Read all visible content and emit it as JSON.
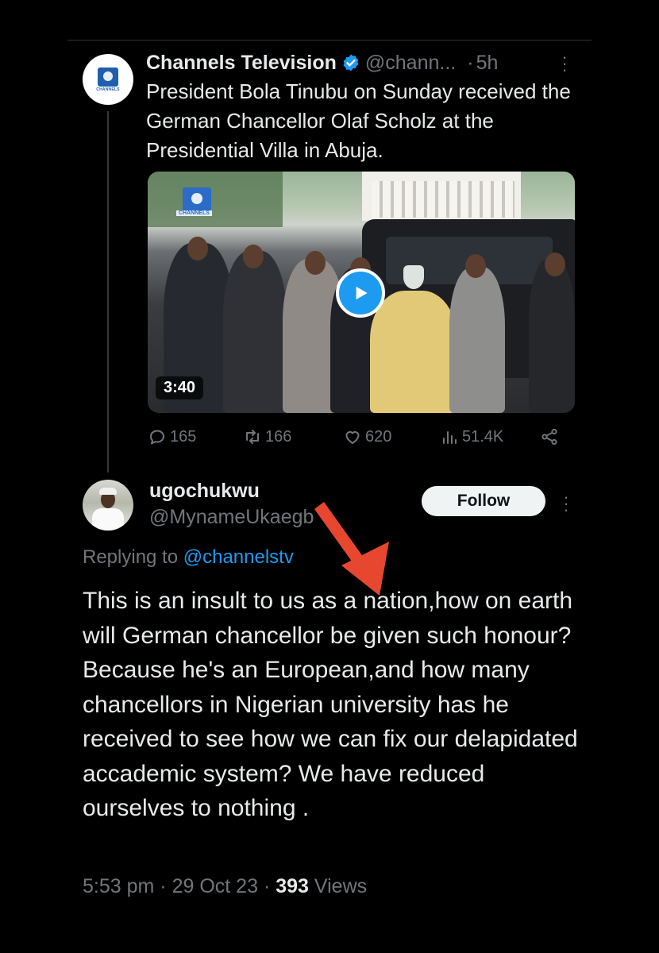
{
  "parent_tweet": {
    "author_name": "Channels Television",
    "author_handle": "@chann...",
    "time_separator": "·",
    "time": "5h",
    "avatar_label": "CHANNELS",
    "text": "President Bola Tinubu on Sunday received the German Chancellor Olaf Scholz at the Presidential Villa in Abuja.",
    "video": {
      "duration": "3:40",
      "logo_label": "CHANNELS"
    },
    "stats": {
      "replies": "165",
      "reposts": "166",
      "likes": "620",
      "views": "51.4K"
    }
  },
  "reply": {
    "author_name": "ugochukwu",
    "author_handle": "@MynameUkaegb",
    "follow_label": "Follow",
    "replying_prefix": "Replying to",
    "replying_to": "@channelstv",
    "text": "This is an insult to us as a nation,how on earth will German chancellor be given such honour? Because he's an European,and how many chancellors in Nigerian university has he received to see how we can fix our delapidated accademic system? We have reduced ourselves to nothing .",
    "time": "5:53 pm",
    "date": "29 Oct 23",
    "separator": "·",
    "views_count": "393",
    "views_label": "Views"
  },
  "colors": {
    "background": "#000000",
    "text_primary": "#e7e9ea",
    "text_secondary": "#71767b",
    "accent": "#1d9bf0",
    "annotation_arrow": "#e8472f"
  }
}
